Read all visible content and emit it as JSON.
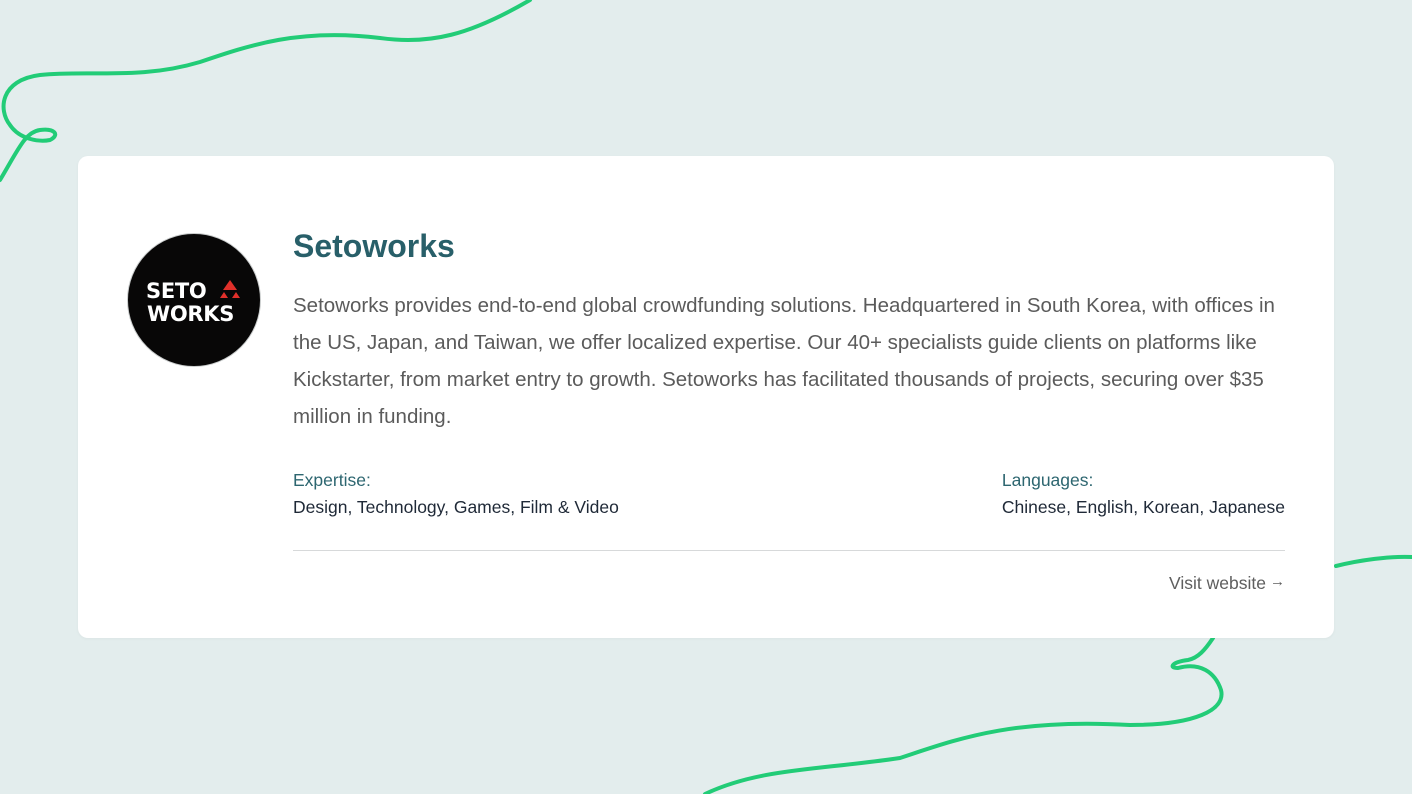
{
  "company": {
    "name": "Setoworks",
    "logo_text": [
      "SETO",
      "WORKS"
    ],
    "description": "Setoworks provides end-to-end global crowdfunding solutions. Headquartered in South Korea, with offices in the US, Japan, and Taiwan, we offer localized expertise. Our 40+ specialists guide clients on platforms like Kickstarter, from market entry to growth. Setoworks has facilitated thousands of projects, securing over $35 million in funding.",
    "expertise_label": "Expertise:",
    "expertise_value": "Design, Technology, Games, Film & Video",
    "languages_label": "Languages:",
    "languages_value": "Chinese, English, Korean, Japanese",
    "visit_label": "Visit website",
    "arrow_glyph": "→"
  },
  "colors": {
    "background": "#e3eded",
    "accent_line": "#22cc77",
    "title": "#285f69",
    "logo_bg": "#080707",
    "logo_accent": "#e0302a"
  },
  "icons": {
    "logo_mark": "red-triangle-icon",
    "link_arrow": "arrow-right-icon"
  }
}
